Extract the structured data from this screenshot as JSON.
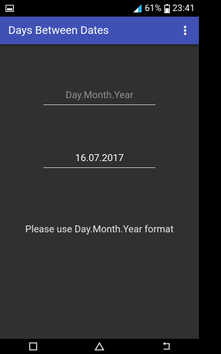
{
  "status_bar": {
    "battery": "61%",
    "time": "23:41",
    "left_icon": "image-notification-icon",
    "signal_icon": "signal-icon",
    "battery_icon": "battery-icon"
  },
  "app_bar": {
    "title": "Days Between Dates",
    "overflow_icon": "more-vert-icon",
    "background": "#3f51b5"
  },
  "form": {
    "first_date_placeholder": "Day.Month.Year",
    "second_date_value": "16.07.2017",
    "hint": "Please use Day.Month.Year format"
  },
  "nav_bar": {
    "recents_icon": "recents-icon",
    "home_icon": "home-icon",
    "back_icon": "back-icon"
  },
  "colors": {
    "background": "#303030",
    "accent": "#3f51b5"
  }
}
